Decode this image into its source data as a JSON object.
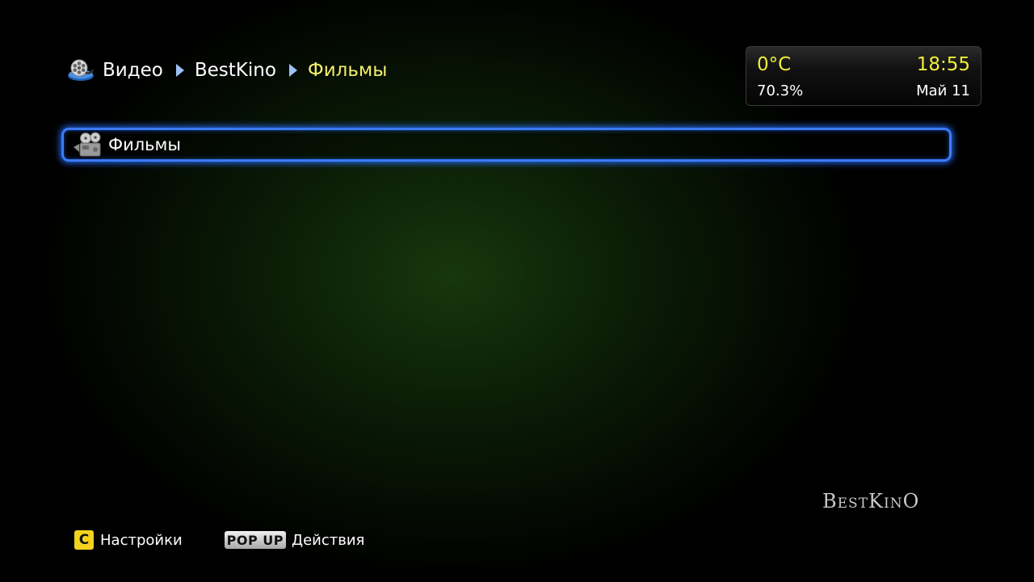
{
  "breadcrumb": {
    "items": [
      {
        "label": "Видео"
      },
      {
        "label": "BestKino"
      },
      {
        "label": "Фильмы"
      }
    ],
    "icon": "video-reel-icon"
  },
  "status": {
    "temperature": "0°C",
    "time": "18:55",
    "humidity": "70.3%",
    "date": "Май 11"
  },
  "list": {
    "items": [
      {
        "label": "Фильмы",
        "icon": "movie-camera-icon",
        "selected": true
      }
    ]
  },
  "brand": {
    "b": "B",
    "est": "EST",
    "k": "K",
    "in": "IN",
    "o": "O"
  },
  "footer": {
    "hints": [
      {
        "key": "C",
        "label": "Настройки"
      },
      {
        "key": "POP UP",
        "label": "Действия"
      }
    ]
  },
  "colors": {
    "accent_yellow": "#f2ee3a",
    "selection_blue": "#3b7bff",
    "arrow_blue": "#9cc1f5"
  }
}
